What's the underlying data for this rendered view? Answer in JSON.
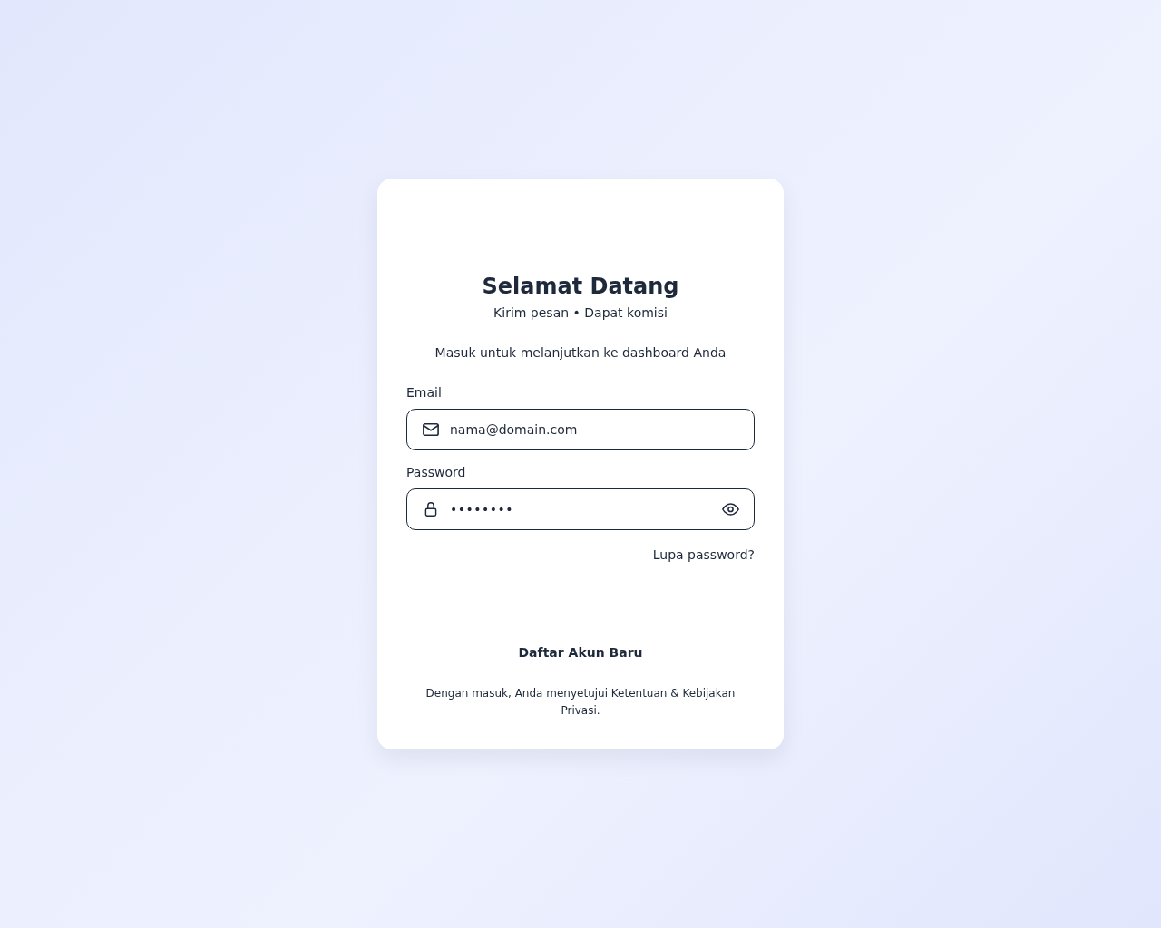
{
  "card": {
    "title": "Selamat Datang",
    "tagline": "Kirim pesan • Dapat komisi",
    "subtitle": "Masuk untuk melanjutkan ke dashboard Anda"
  },
  "form": {
    "fields": [
      {
        "kind": "email",
        "label": "Email",
        "value": "nama@domain.com"
      },
      {
        "kind": "password",
        "label": "Password",
        "value": "••••••••"
      }
    ],
    "forgot_link": "Lupa password?"
  },
  "register_link": "Daftar Akun Baru",
  "footer_note": "Dengan masuk, Anda menyetujui Ketentuan & Kebijakan Privasi."
}
